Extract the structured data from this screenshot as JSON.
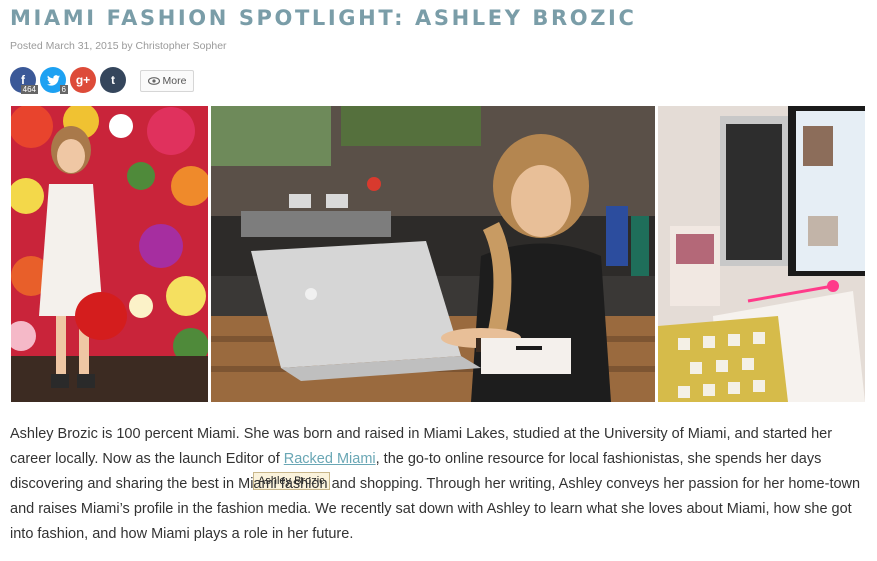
{
  "article": {
    "title": "MIAMI FASHION SPOTLIGHT: ASHLEY BROZIC",
    "meta": "Posted March 31, 2015 by Christopher Sopher"
  },
  "share": {
    "facebook": {
      "icon": "facebook-icon",
      "label": "f",
      "count": "464"
    },
    "twitter": {
      "icon": "twitter-icon",
      "count": "6"
    },
    "googleplus": {
      "icon": "google-plus-icon",
      "label": "g+"
    },
    "tumblr": {
      "icon": "tumblr-icon",
      "label": "t"
    },
    "more": {
      "label": "More",
      "icon": "eye-icon"
    }
  },
  "photos": {
    "caption": "Ashley Brozic"
  },
  "body": {
    "part1": "Ashley Brozic is 100 percent Miami. She was born and raised in Miami Lakes, studied at the University of Miami, and started her career locally. Now as the launch Editor of ",
    "link": "Racked Miami",
    "part2": ", the go-to online resource for local fashionistas, she spends her days discovering and sharing the best in Miami fashion and shopping. Through her writing, Ashley conveys her passion for her home-town and raises Miami’s profile in the fashion media. We recently sat down with Ashley to learn what she loves about Miami, how she got into fashion, and how Miami plays a role in her future."
  },
  "colors": {
    "title": "#7a9da8",
    "link": "#6aa7b5",
    "facebook": "#3b5998",
    "twitter": "#1da1f2",
    "googleplus": "#dd4b39",
    "tumblr": "#35465c"
  }
}
